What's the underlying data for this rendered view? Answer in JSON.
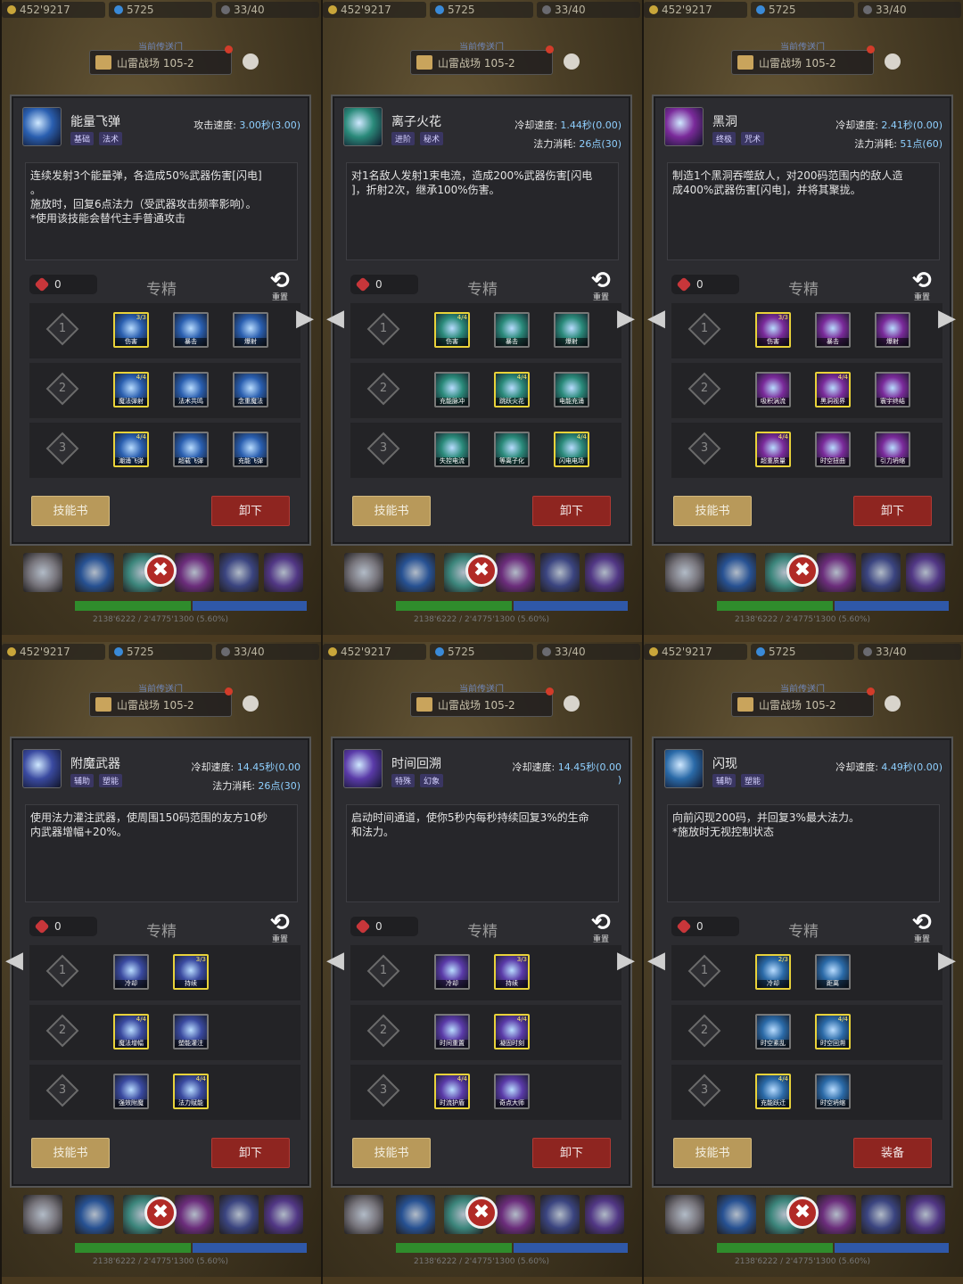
{
  "hud": {
    "gold": "452'9217",
    "gems": "5725",
    "capacity": "33/40",
    "zone_label": "当前传送门",
    "zone_name": "山雷战场 105-2",
    "bottom_stats": "2138'6222 / 2'4775'1300 (5.60%)",
    "close_symbol": "✖"
  },
  "common": {
    "spec_title": "专精",
    "reset_label": "重置",
    "reset_symbol": "⟲",
    "book_button": "技能书",
    "points": "0",
    "nav_left": "◀",
    "nav_right": "▶"
  },
  "colors": {
    "selected_border": "#e8d23a",
    "book_button": "#b8995a",
    "action_button": "#8e2520",
    "stat_value": "#8fd0ff"
  },
  "panels": [
    {
      "name": "能量飞弹",
      "tags": [
        "基础",
        "法术"
      ],
      "stat1_label": "攻击速度:",
      "stat1_value": "3.00秒(3.00)",
      "stat2_label": "",
      "stat2_value": "",
      "description": "连续发射3个能量弹，各造成50%武器伤害[闪电]\n。\n施放时，回复6点法力（受武器攻击频率影响）。\n*使用该技能会替代主手普通攻击",
      "action": "卸下",
      "icon_color": "#2a5fb0",
      "nav": [
        "right"
      ],
      "tiers": [
        [
          {
            "n": "伤害",
            "l": "3/3",
            "s": true
          },
          {
            "n": "暴击",
            "l": "",
            "s": false
          },
          {
            "n": "爆射",
            "l": "",
            "s": false
          }
        ],
        [
          {
            "n": "魔法弹射",
            "l": "4/4",
            "s": true
          },
          {
            "n": "法术共鸣",
            "l": "",
            "s": false
          },
          {
            "n": "念重魔法",
            "l": "",
            "s": false
          }
        ],
        [
          {
            "n": "潮涌飞弹",
            "l": "4/4",
            "s": true
          },
          {
            "n": "超载飞弹",
            "l": "",
            "s": false
          },
          {
            "n": "充能飞弹",
            "l": "",
            "s": false
          }
        ]
      ]
    },
    {
      "name": "离子火花",
      "tags": [
        "进阶",
        "秘术"
      ],
      "stat1_label": "冷却速度:",
      "stat1_value": "1.44秒(0.00)",
      "stat2_label": "法力消耗:",
      "stat2_value": "26点(30)",
      "description": "对1名敌人发射1束电流，造成200%武器伤害[闪电\n]，折射2次，继承100%伤害。",
      "action": "卸下",
      "icon_color": "#2a8a7a",
      "nav": [
        "left",
        "right"
      ],
      "tiers": [
        [
          {
            "n": "伤害",
            "l": "4/4",
            "s": true
          },
          {
            "n": "暴击",
            "l": "",
            "s": false
          },
          {
            "n": "爆射",
            "l": "",
            "s": false
          }
        ],
        [
          {
            "n": "充能脉冲",
            "l": "",
            "s": false
          },
          {
            "n": "跳跃火花",
            "l": "4/4",
            "s": true
          },
          {
            "n": "电能充涌",
            "l": "",
            "s": false
          }
        ],
        [
          {
            "n": "失控电流",
            "l": "",
            "s": false
          },
          {
            "n": "等离子化",
            "l": "",
            "s": false
          },
          {
            "n": "闪电电场",
            "l": "4/4",
            "s": true
          }
        ]
      ]
    },
    {
      "name": "黑洞",
      "tags": [
        "终极",
        "咒术"
      ],
      "stat1_label": "冷却速度:",
      "stat1_value": "2.41秒(0.00)",
      "stat2_label": "法力消耗:",
      "stat2_value": "51点(60)",
      "description": "制造1个黑洞吞噬敌人，对200码范围内的敌人造\n成400%武器伤害[闪电]，并将其聚拢。",
      "action": "卸下",
      "icon_color": "#7a2a9a",
      "nav": [
        "left",
        "right"
      ],
      "tiers": [
        [
          {
            "n": "伤害",
            "l": "3/3",
            "s": true
          },
          {
            "n": "暴击",
            "l": "",
            "s": false
          },
          {
            "n": "爆射",
            "l": "",
            "s": false
          }
        ],
        [
          {
            "n": "吸积涡流",
            "l": "",
            "s": false
          },
          {
            "n": "黑洞视界",
            "l": "4/4",
            "s": true
          },
          {
            "n": "寰宇终结",
            "l": "",
            "s": false
          }
        ],
        [
          {
            "n": "超重质量",
            "l": "4/4",
            "s": true
          },
          {
            "n": "时空扭曲",
            "l": "",
            "s": false
          },
          {
            "n": "引力坍缩",
            "l": "",
            "s": false
          }
        ]
      ]
    },
    {
      "name": "附魔武器",
      "tags": [
        "辅助",
        "塑能"
      ],
      "stat1_label": "冷却速度:",
      "stat1_value": "14.45秒(0.00",
      "stat2_label": "法力消耗:",
      "stat2_value": "26点(30)",
      "description": "使用法力灌注武器，使周围150码范围的友方10秒\n内武器增幅+20%。",
      "action": "卸下",
      "icon_color": "#3a4aa0",
      "nav": [
        "left"
      ],
      "tiers": [
        [
          {
            "n": "冷却",
            "l": "",
            "s": false
          },
          {
            "n": "持续",
            "l": "3/3",
            "s": true
          }
        ],
        [
          {
            "n": "魔法增幅",
            "l": "4/4",
            "s": true
          },
          {
            "n": "塑能灌注",
            "l": "",
            "s": false
          }
        ],
        [
          {
            "n": "强效附魔",
            "l": "",
            "s": false
          },
          {
            "n": "法力赋能",
            "l": "4/4",
            "s": true
          }
        ]
      ]
    },
    {
      "name": "时间回溯",
      "tags": [
        "特殊",
        "幻象"
      ],
      "stat1_label": "冷却速度:",
      "stat1_value": "14.45秒(0.00\n)",
      "stat2_label": "",
      "stat2_value": "",
      "description": "启动时间通道，使你5秒内每秒持续回复3%的生命\n和法力。",
      "action": "卸下",
      "icon_color": "#5a3aa8",
      "nav": [
        "left",
        "right"
      ],
      "tiers": [
        [
          {
            "n": "冷却",
            "l": "",
            "s": false
          },
          {
            "n": "持续",
            "l": "3/3",
            "s": true
          }
        ],
        [
          {
            "n": "时间重置",
            "l": "",
            "s": false
          },
          {
            "n": "凝固时刻",
            "l": "4/4",
            "s": true
          }
        ],
        [
          {
            "n": "时流护盾",
            "l": "4/4",
            "s": true
          },
          {
            "n": "奇点大师",
            "l": "",
            "s": false
          }
        ]
      ]
    },
    {
      "name": "闪现",
      "tags": [
        "辅助",
        "塑能"
      ],
      "stat1_label": "冷却速度:",
      "stat1_value": "4.49秒(0.00)",
      "stat2_label": "",
      "stat2_value": "",
      "description": "向前闪现200码，并回复3%最大法力。\n*施放时无视控制状态",
      "action": "装备",
      "icon_color": "#2a6aa8",
      "nav": [
        "left",
        "right"
      ],
      "tiers": [
        [
          {
            "n": "冷却",
            "l": "2/3",
            "s": true
          },
          {
            "n": "距离",
            "l": "",
            "s": false
          }
        ],
        [
          {
            "n": "时空紊乱",
            "l": "",
            "s": false
          },
          {
            "n": "时空回溯",
            "l": "4/4",
            "s": true
          }
        ],
        [
          {
            "n": "充能跃迁",
            "l": "4/4",
            "s": true
          },
          {
            "n": "时空坍缩",
            "l": "",
            "s": false
          }
        ]
      ]
    }
  ]
}
